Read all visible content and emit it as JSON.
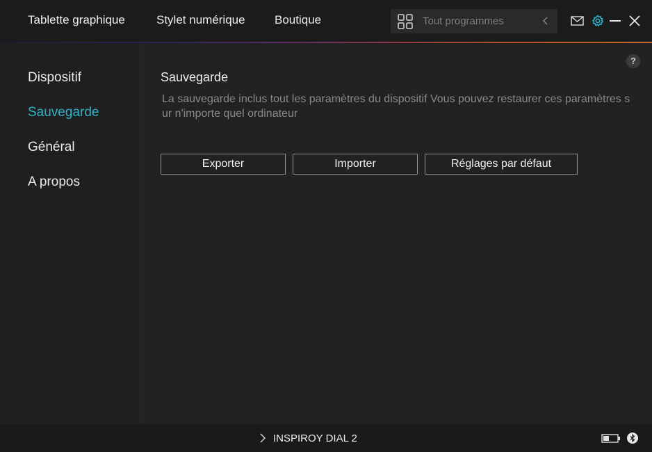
{
  "header": {
    "tabs": [
      {
        "label": "Tablette graphique"
      },
      {
        "label": "Stylet numérique"
      },
      {
        "label": "Boutique"
      }
    ],
    "search": {
      "placeholder": "Tout programmes"
    },
    "icons": [
      "grid-icon",
      "chevron-left-icon",
      "mail-icon",
      "gear-icon",
      "minimize-icon",
      "close-icon"
    ]
  },
  "sidebar": {
    "items": [
      {
        "label": "Dispositif",
        "active": false
      },
      {
        "label": "Sauvegarde",
        "active": true
      },
      {
        "label": "Général",
        "active": false
      },
      {
        "label": "A propos",
        "active": false
      }
    ]
  },
  "main": {
    "help_label": "?",
    "title": "Sauvegarde",
    "description": "La sauvegarde inclus tout les paramètres du dispositif Vous pouvez restaurer ces paramètres sur n'importe quel ordinateur",
    "buttons": {
      "export_label": "Exporter",
      "import_label": "Importer",
      "defaults_label": "Réglages par défaut"
    }
  },
  "footer": {
    "device_name": "INSPIROY DIAL 2"
  },
  "colors": {
    "accent": "#2fb3c9",
    "background": "#222222",
    "header_bg": "#1b1b1b",
    "sidebar_bg": "#1f1f1f",
    "muted_text": "#8a8a8a"
  }
}
